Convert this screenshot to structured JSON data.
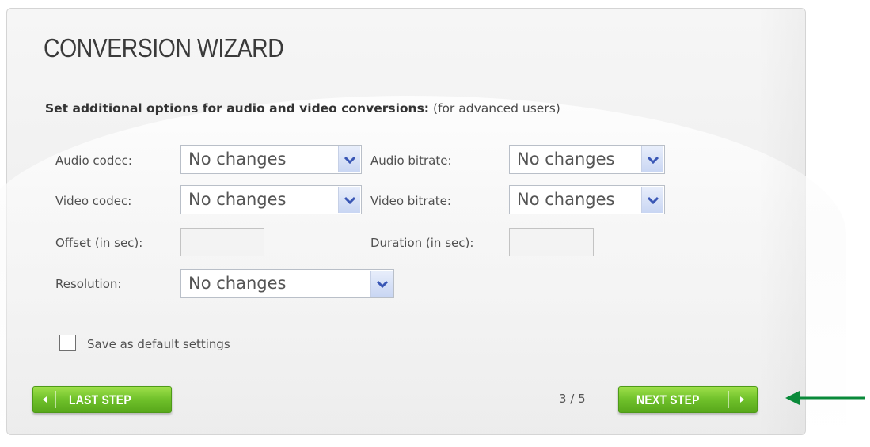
{
  "wizard": {
    "title": "CONVERSION WIZARD",
    "subtitle_bold": "Set additional options for audio and video conversions:",
    "subtitle_note": " (for advanced users)"
  },
  "fields": {
    "audio_codec": {
      "label": "Audio codec:",
      "value": "No changes"
    },
    "audio_bitrate": {
      "label": "Audio bitrate:",
      "value": "No changes"
    },
    "video_codec": {
      "label": "Video codec:",
      "value": "No changes"
    },
    "video_bitrate": {
      "label": "Video bitrate:",
      "value": "No changes"
    },
    "offset": {
      "label": "Offset (in sec):",
      "value": ""
    },
    "duration": {
      "label": "Duration (in sec):",
      "value": ""
    },
    "resolution": {
      "label": "Resolution:",
      "value": "No changes"
    }
  },
  "save_default": {
    "label": "Save as default settings",
    "checked": false
  },
  "nav": {
    "last_step": "LAST STEP",
    "next_step": "NEXT STEP",
    "page": "3 / 5"
  },
  "colors": {
    "button_green": "#6fc02a",
    "arrow_green": "#0a8a3a",
    "dropdown_arrow": "#3a57b5"
  }
}
